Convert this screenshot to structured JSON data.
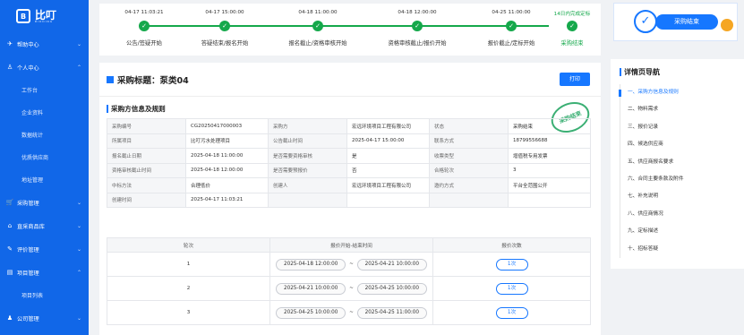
{
  "brand": {
    "name": "比叮",
    "sub": "BIDDING",
    "mark": "B"
  },
  "sidebar": {
    "items": [
      {
        "key": "help",
        "label": "帮助中心",
        "icon": "✈",
        "chev": "⌄"
      },
      {
        "key": "personal",
        "label": "个人中心",
        "icon": "♙",
        "chev": "⌃"
      },
      {
        "key": "procure",
        "label": "采购管理",
        "icon": "🛒",
        "chev": "⌄"
      },
      {
        "key": "mall",
        "label": "直采商品库",
        "icon": "⌂",
        "chev": "⌄"
      },
      {
        "key": "review",
        "label": "评价管理",
        "icon": "✎",
        "chev": "⌄"
      },
      {
        "key": "project",
        "label": "项目管理",
        "icon": "▤",
        "chev": "⌃"
      },
      {
        "key": "company",
        "label": "公司管理",
        "icon": "♟",
        "chev": "⌄"
      }
    ],
    "personal_sub": [
      "工作台",
      "企业资料",
      "数据统计",
      "优质供应商",
      "地址管理"
    ],
    "project_sub": [
      "项目列表"
    ]
  },
  "steps": [
    {
      "date": "04-17 11:03:21",
      "name": "公告/签疑开始"
    },
    {
      "date": "04-17 15:00:00",
      "name": "答疑结束/报名开始"
    },
    {
      "date": "04-18 11:00:00",
      "name": "报名截止/资格审核开始"
    },
    {
      "date": "04-18 12:00:00",
      "name": "资格审核截止/报价开始"
    },
    {
      "date": "04-25 11:00:00",
      "name": "报价截止/定标开始"
    },
    {
      "date": "14日内完成定标",
      "name": "采购结束"
    }
  ],
  "status_banner": {
    "label": "采购结束",
    "check": "✓"
  },
  "page": {
    "title": "采购标题：泵类04",
    "print_label": "打印",
    "section": "采购方信息及规则",
    "stamp": "采购结束"
  },
  "info_rows": [
    [
      "采购编号",
      "CG20250417000003",
      "采购方",
      "宏远环境项目工程有限公司",
      "状态",
      "采购结束"
    ],
    [
      "所属项目",
      "比叮污水处理项目",
      "公告截止时间",
      "2025-04-17 15:00:00",
      "联系方式",
      "18799556688"
    ],
    [
      "报名截止日期",
      "2025-04-18 11:00:00",
      "是否需要资格审核",
      "是",
      "收票类型",
      "增值税专用发票"
    ],
    [
      "资格审核截止时间",
      "2025-04-18 12:00:00",
      "是否需要预报价",
      "否",
      "合格轮次",
      "3"
    ],
    [
      "中标方法",
      "合理低价",
      "创建人",
      "宏远环境项目工程有限公司",
      "邀约方式",
      "平台全范围公开"
    ],
    [
      "创建时间",
      "2025-04-17 11:03:21",
      "",
      "",
      "",
      ""
    ]
  ],
  "rounds": {
    "headers": [
      "轮次",
      "报价开始-结束时间",
      "报价次数"
    ],
    "rows": [
      {
        "n": "1",
        "start": "2025-04-18 12:00:00",
        "end": "2025-04-21 10:00:00",
        "count": "1次"
      },
      {
        "n": "2",
        "start": "2025-04-21 10:00:00",
        "end": "2025-04-25 10:00:00",
        "count": "1次"
      },
      {
        "n": "3",
        "start": "2025-04-25 10:00:00",
        "end": "2025-04-25 11:00:00",
        "count": "1次"
      }
    ],
    "sep": "~"
  },
  "detail_nav": {
    "title": "详情页导航",
    "items": [
      "一、采购方信息及规则",
      "二、物料需求",
      "三、报价记录",
      "四、候选供应商",
      "五、供应商报名要求",
      "六、合同主要条款及附件",
      "七、补充说明",
      "八、供应商情况",
      "九、定标描述",
      "十、招标答疑"
    ]
  }
}
